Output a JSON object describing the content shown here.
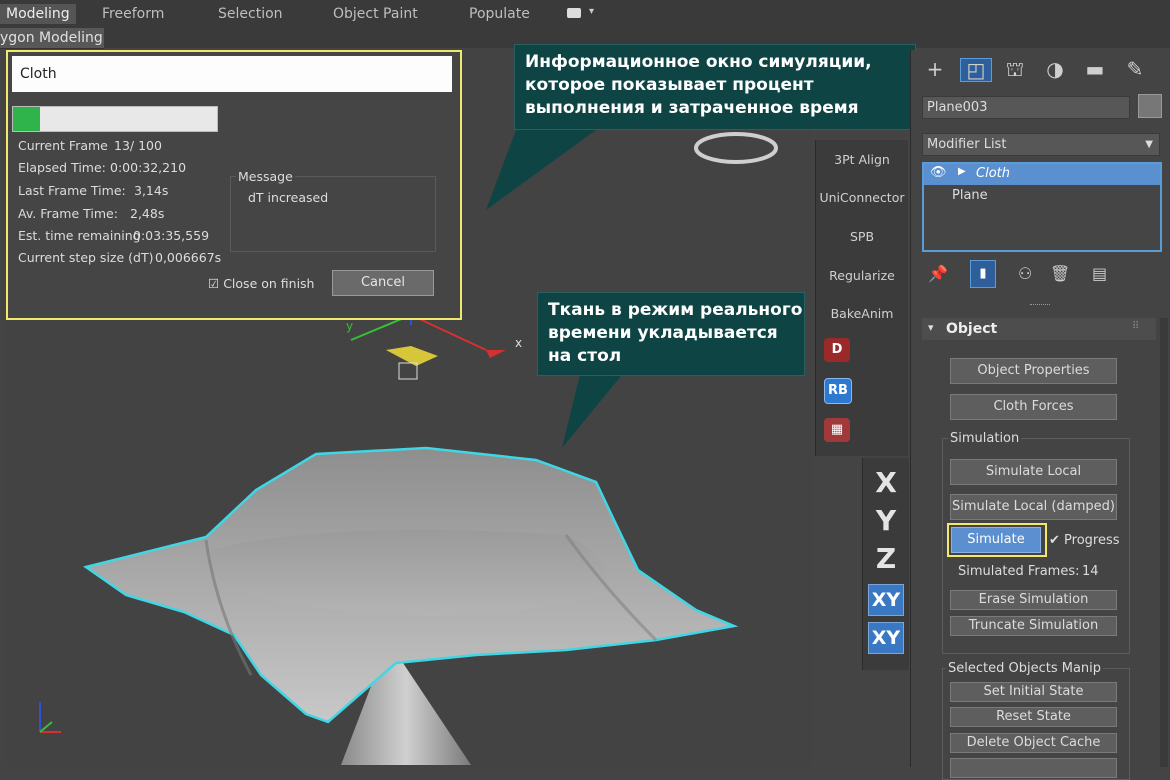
{
  "ribbon": {
    "tabs": [
      "Modeling",
      "Freeform",
      "Selection",
      "Object Paint",
      "Populate"
    ],
    "subtab": "ygon Modeling"
  },
  "cloth_window": {
    "title": "Cloth",
    "progress": 0.13,
    "stats": [
      {
        "label": "Current Frame",
        "value": "13/  100"
      },
      {
        "label": "Elapsed Time:",
        "value": "0:00:32,210"
      },
      {
        "label": "Last Frame Time:",
        "value": "3,14s"
      },
      {
        "label": "Av. Frame Time:",
        "value": "2,48s"
      },
      {
        "label": "Est. time remaining",
        "value": "0:03:35,559"
      },
      {
        "label": "Current step size (dT)",
        "value": "0,006667s"
      }
    ],
    "message_label": "Message",
    "message_text": "dT increased",
    "close_on_finish": "Close on finish",
    "cancel": "Cancel"
  },
  "callouts": {
    "info": "Информационное окно симуляции, которое показывает процент выполнения и затраченное время",
    "cloth": "Ткань в режим реального времени укладывается на стол"
  },
  "gizmo": {
    "x": "x",
    "y": "y"
  },
  "utilities": [
    "3Pt Align",
    "UniConnector",
    "SPB",
    "Regularize",
    "BakeAnim"
  ],
  "util_icons": {
    "rb": "RB"
  },
  "axis": {
    "x": "X",
    "y": "Y",
    "z": "Z",
    "xy": "XY",
    "xy2": "XY"
  },
  "command_panel": {
    "object_name": "Plane003",
    "modifier_list": "Modifier List",
    "stack": [
      "Cloth",
      "Plane"
    ],
    "rollout_title": "Object",
    "object_properties": "Object Properties",
    "cloth_forces": "Cloth Forces",
    "simulation_group": "Simulation",
    "simulate_local": "Simulate Local",
    "simulate_local_damped": "Simulate Local (damped)",
    "simulate": "Simulate",
    "progress": "Progress",
    "simulated_frames_label": "Simulated Frames:",
    "simulated_frames_value": "14",
    "erase_simulation": "Erase Simulation",
    "truncate_simulation": "Truncate Simulation",
    "selected_group": "Selected Objects Manip",
    "set_initial_state": "Set Initial State",
    "reset_state": "Reset State",
    "delete_object_cache": "Delete Object Cache"
  },
  "colors": {
    "accent": "#5a9bd8",
    "highlight": "#f1e86c",
    "callout": "#0f4444",
    "progress": "#2fb44b",
    "cloth_outline": "#3fd6e6"
  }
}
